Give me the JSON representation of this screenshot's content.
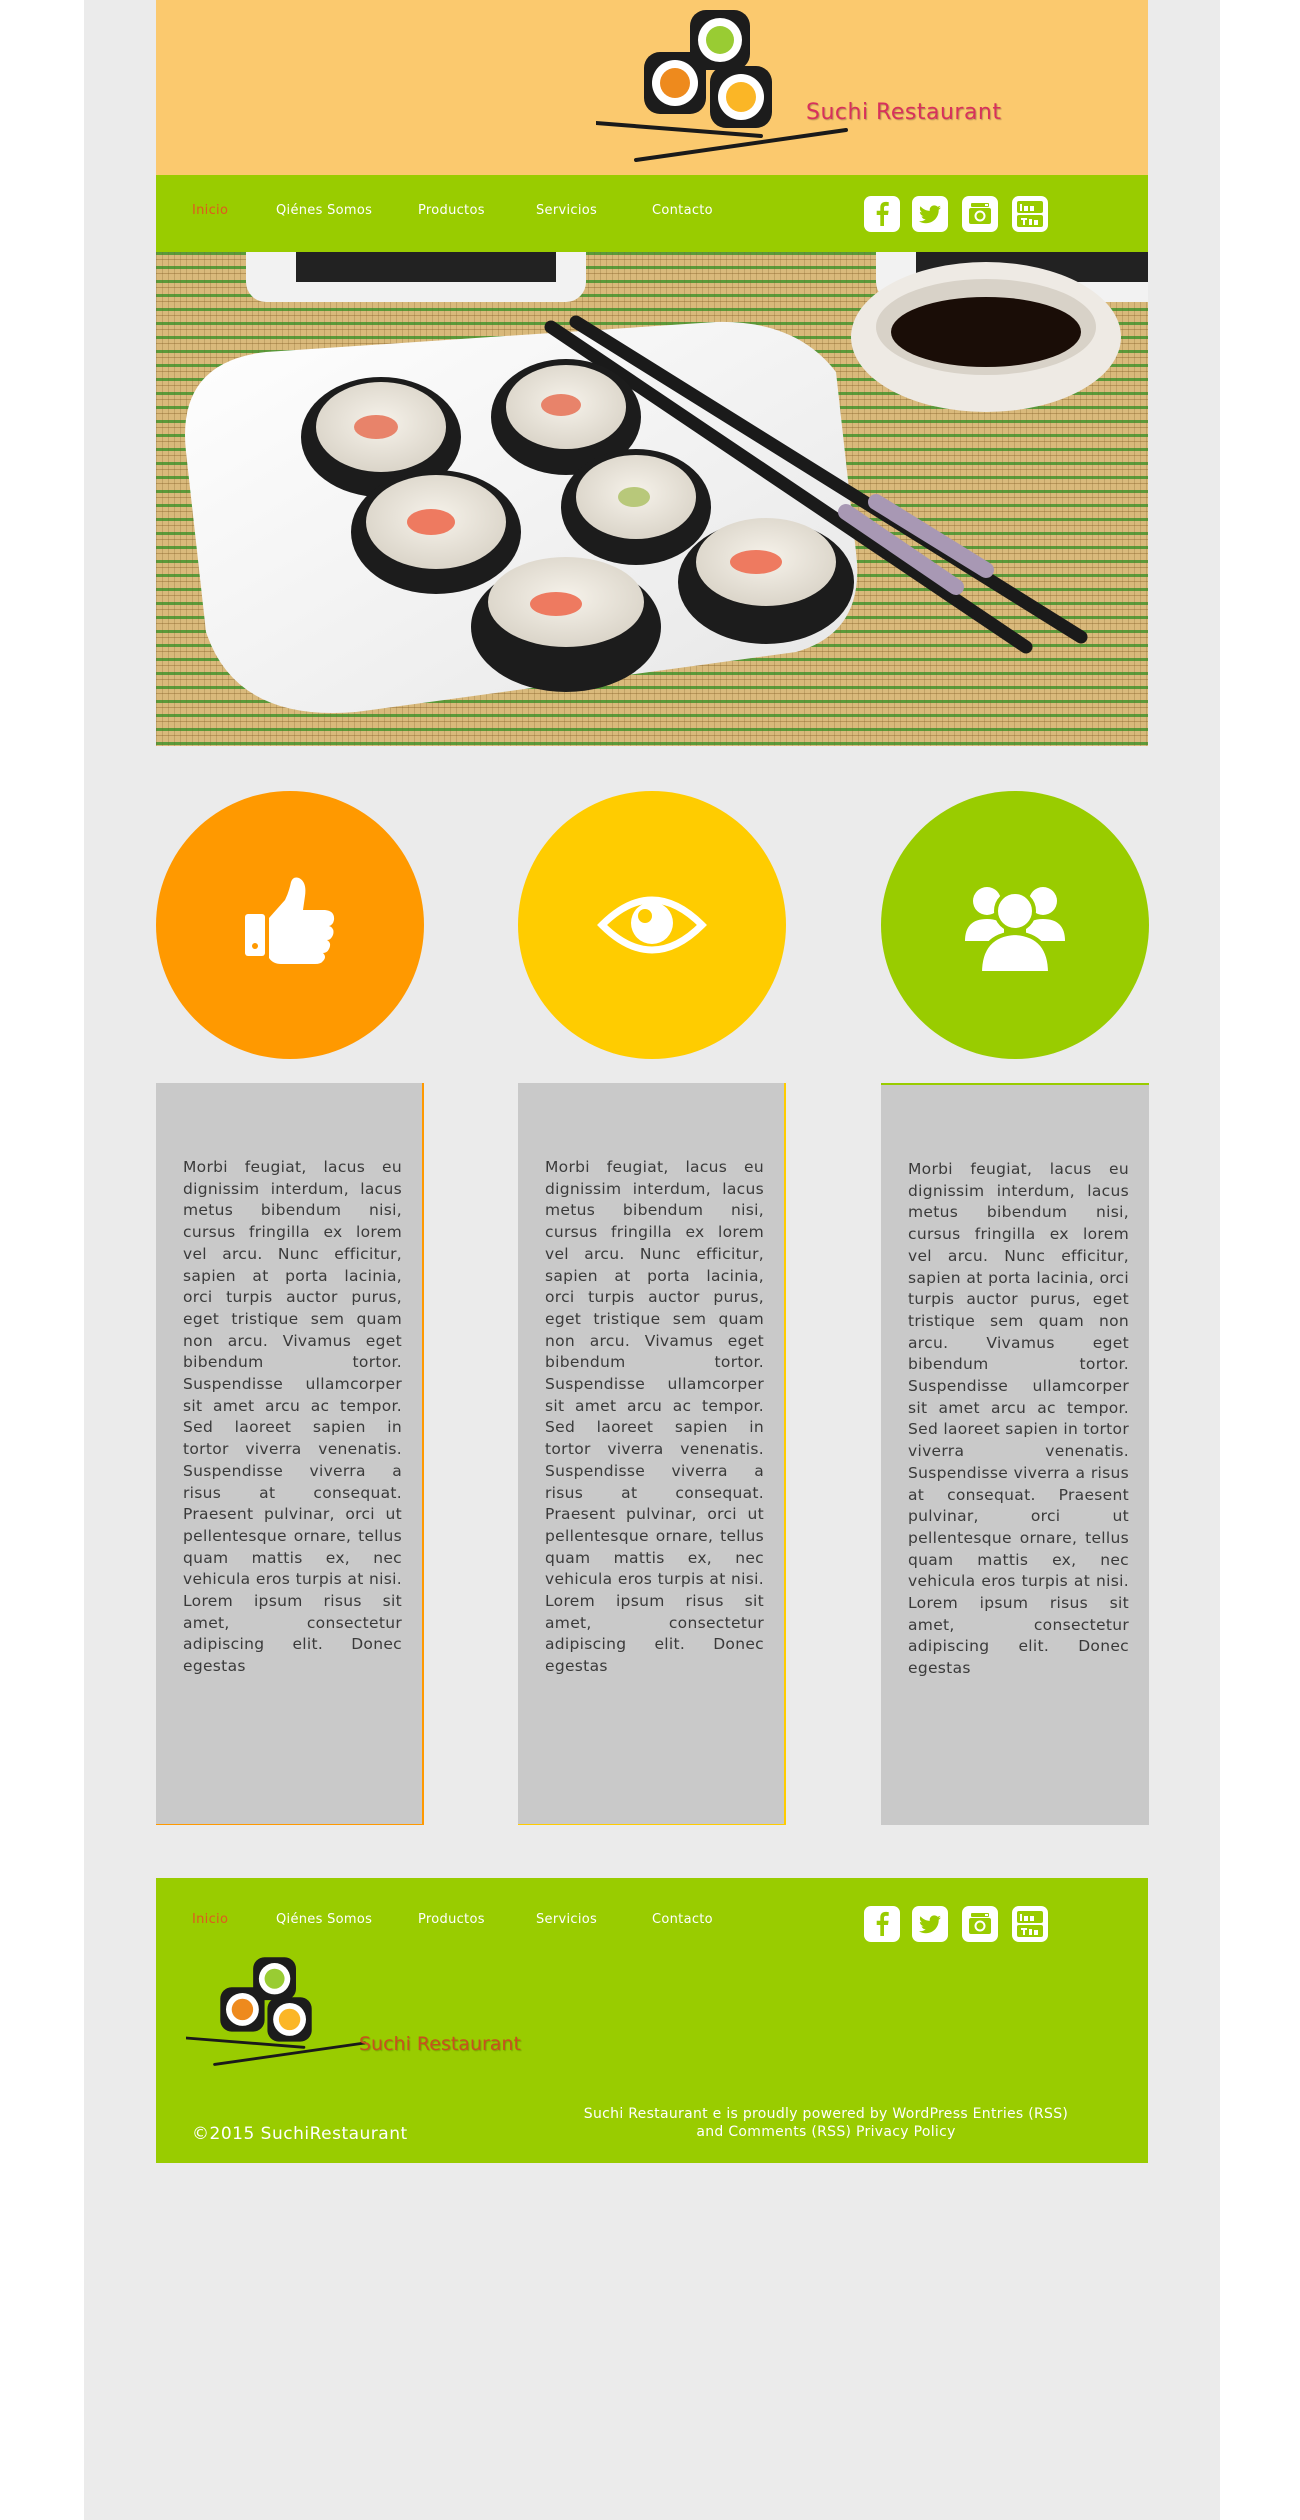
{
  "brand": {
    "name": "Suchi Restaurant"
  },
  "nav": {
    "items": [
      {
        "label": "Inicio",
        "active": true
      },
      {
        "label": "Qiénes Somos",
        "active": false
      },
      {
        "label": "Productos",
        "active": false
      },
      {
        "label": "Servicios",
        "active": false
      },
      {
        "label": "Contacto",
        "active": false
      }
    ],
    "social": [
      "facebook-icon",
      "twitter-icon",
      "instagram-icon",
      "youtube-icon"
    ]
  },
  "features": [
    {
      "icon": "thumbs-up-icon",
      "color": "#ff9900"
    },
    {
      "icon": "eye-icon",
      "color": "#ffcc00"
    },
    {
      "icon": "users-icon",
      "color": "#99cc00"
    }
  ],
  "columns": [
    {
      "text": "Morbi feugiat, lacus eu dignissim interdum, lacus metus bibendum nisi, cursus fringilla ex lorem vel arcu. Nunc efficitur, sapien at porta lacinia, orci turpis auctor purus, eget tristique sem quam non arcu. Vivamus eget bibendum tortor. Suspendisse ullamcorper sit amet arcu ac tempor. Sed laoreet sapien in tortor viverra venenatis. Suspendisse viverra a risus at consequat. Praesent pulvinar, orci ut pellentesque ornare, tellus quam mattis ex, nec vehicula eros turpis at nisi. Lorem ipsum risus sit amet, consectetur adipiscing elit. Donec egestas"
    },
    {
      "text": "Morbi feugiat, lacus eu dignissim interdum, lacus metus bibendum nisi, cursus fringilla ex lorem vel arcu. Nunc efficitur, sapien at porta lacinia, orci turpis auctor purus, eget tristique sem quam non arcu. Vivamus eget bibendum tortor. Suspendisse ullamcorper sit amet arcu ac tempor. Sed laoreet sapien in tortor viverra venenatis. Suspendisse viverra a risus at consequat. Praesent pulvinar, orci ut pellentesque ornare, tellus quam mattis ex, nec vehicula eros turpis at nisi. Lorem ipsum risus sit amet, consectetur adipiscing elit. Donec egestas"
    },
    {
      "text": "Morbi feugiat, lacus eu dignissim interdum, lacus metus bibendum nisi, cursus fringilla ex lorem vel arcu. Nunc efficitur, sapien at porta lacinia, orci turpis auctor purus, eget tristique sem quam non arcu. Vivamus eget bibendum tortor. Suspendisse ullamcorper sit amet arcu ac tempor. Sed laoreet sapien in tortor viverra venenatis. Suspendisse viverra a risus at consequat. Praesent pulvinar, orci ut pellentesque ornare, tellus quam mattis ex, nec vehicula eros turpis at nisi. Lorem ipsum risus sit amet, consectetur adipiscing elit. Donec egestas"
    }
  ],
  "footer": {
    "copyright": "©2015 SuchiRestaurant",
    "powered_line1": "Suchi Restaurant e is proudly powered by WordPress Entries (RSS)",
    "powered_line2": "and Comments (RSS) Privacy Policy"
  },
  "colors": {
    "header_bg": "#fbc96e",
    "nav_bg": "#99cc00",
    "active_link": "#e0591e",
    "brand_text": "#d8305c",
    "page_bg": "#ebebeb",
    "column_bg": "#c9c9c9"
  }
}
